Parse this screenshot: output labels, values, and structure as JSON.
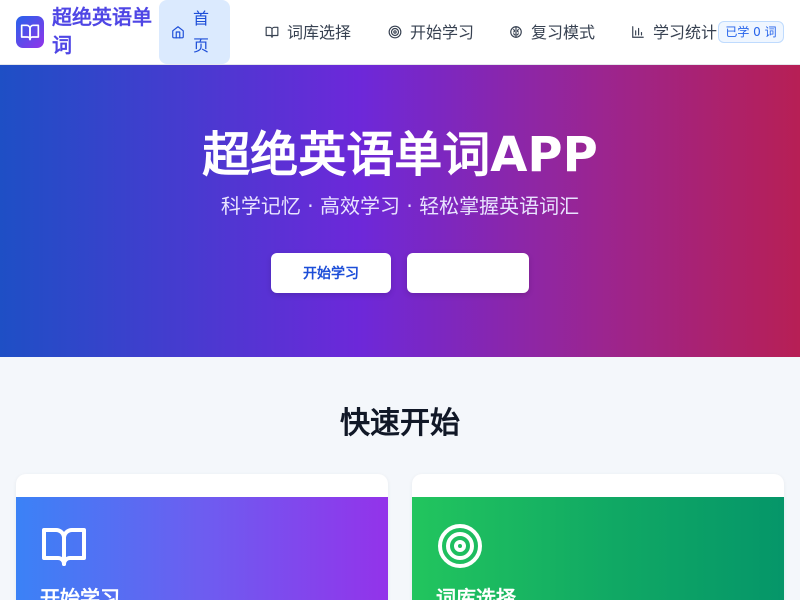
{
  "app": {
    "brand": "超绝英语单词"
  },
  "nav": {
    "items": [
      {
        "label": "首页",
        "icon": "home-icon",
        "active": true
      },
      {
        "label": "词库选择",
        "icon": "book-open-icon",
        "active": false
      },
      {
        "label": "开始学习",
        "icon": "target-icon",
        "active": false
      },
      {
        "label": "复习模式",
        "icon": "brain-icon",
        "active": false
      },
      {
        "label": "学习统计",
        "icon": "bar-chart-icon",
        "active": false
      }
    ],
    "learned_badge": "已学 0 词"
  },
  "hero": {
    "title": "超绝英语单词APP",
    "subtitle": "科学记忆 · 高效学习 · 轻松掌握英语词汇",
    "primary_button": "开始学习",
    "secondary_button": ""
  },
  "quick_start": {
    "title": "快速开始",
    "cards": [
      {
        "title": "开始学习",
        "icon": "book-open-icon"
      },
      {
        "title": "词库选择",
        "icon": "target-icon"
      }
    ]
  },
  "colors": {
    "brand": "#4f46e5",
    "active_nav_bg": "#dbeafe",
    "active_nav_text": "#1d4ed8",
    "hero_gradient_start": "#1e4fc5",
    "hero_gradient_end": "#b71f55",
    "card_blue": "#3b82f6",
    "card_purple": "#9333ea",
    "card_green": "#22c55e",
    "card_teal": "#059669"
  }
}
